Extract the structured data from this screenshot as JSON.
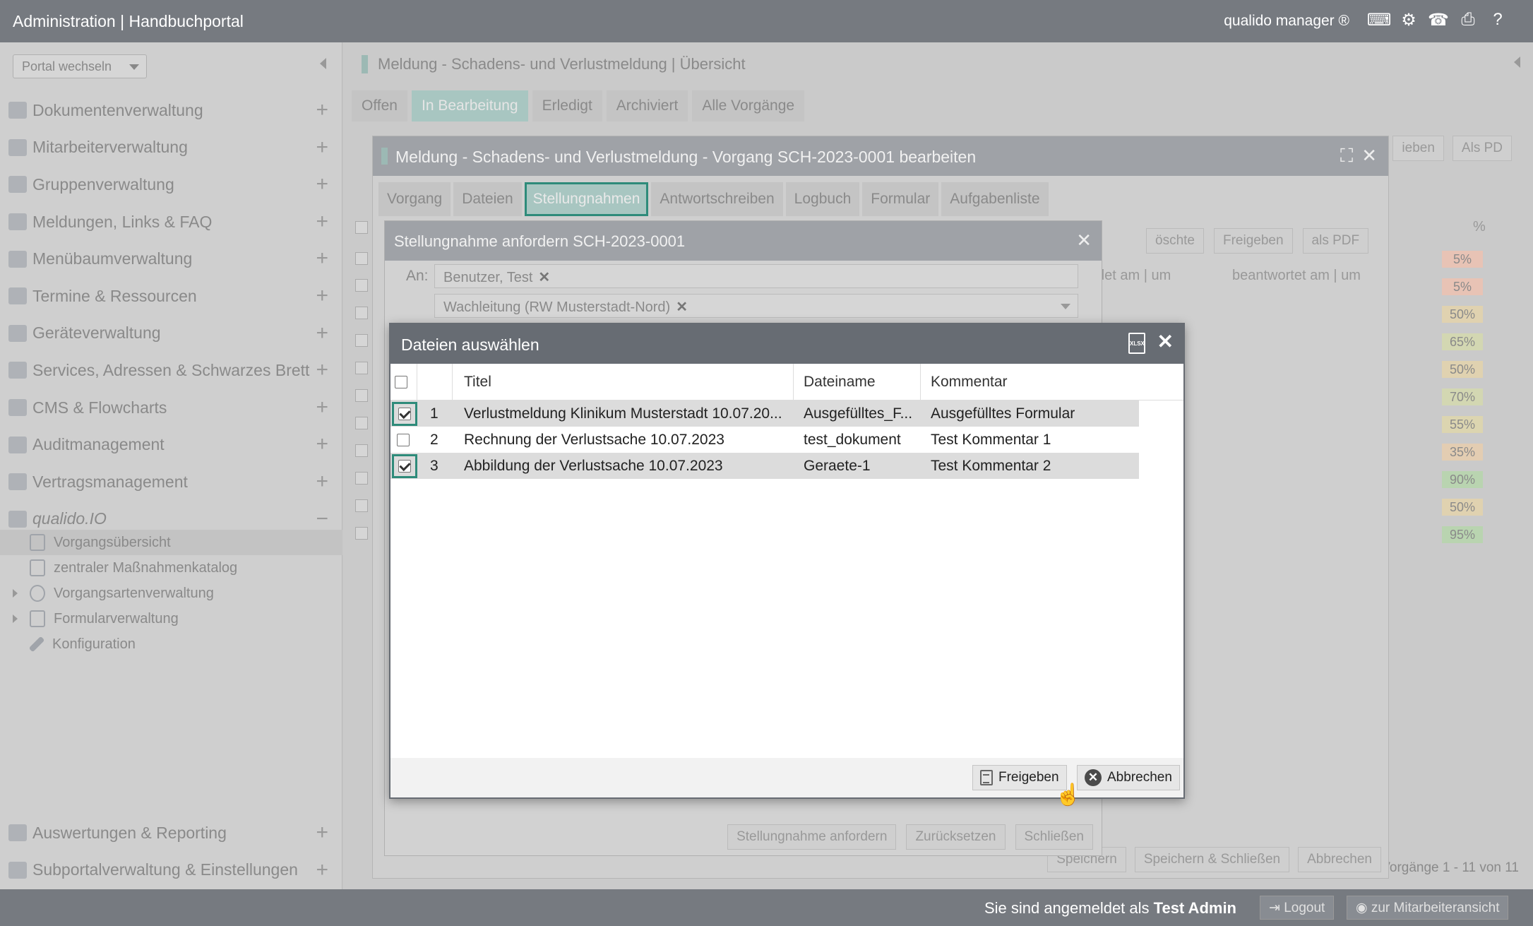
{
  "topbar": {
    "title": "Administration | Handbuchportal",
    "brand": "qualido manager ®",
    "icons": [
      "keyboard-icon",
      "settings-icon",
      "fax-icon",
      "print-icon",
      "help-icon"
    ]
  },
  "sidebar": {
    "portal_select": "Portal wechseln",
    "items": [
      {
        "label": "Dokumentenverwaltung",
        "icon": "documents-icon"
      },
      {
        "label": "Mitarbeiterverwaltung",
        "icon": "users-icon"
      },
      {
        "label": "Gruppenverwaltung",
        "icon": "groups-icon"
      },
      {
        "label": "Meldungen, Links & FAQ",
        "icon": "chat-icon"
      },
      {
        "label": "Menübaumverwaltung",
        "icon": "menu-tree-icon"
      },
      {
        "label": "Termine & Ressourcen",
        "icon": "calendar-icon"
      },
      {
        "label": "Geräteverwaltung",
        "icon": "device-icon"
      },
      {
        "label": "Services, Adressen & Schwarzes Brett",
        "icon": "address-book-icon"
      },
      {
        "label": "CMS & Flowcharts",
        "icon": "cms-icon"
      },
      {
        "label": "Auditmanagement",
        "icon": "audit-icon"
      },
      {
        "label": "Vertragsmanagement",
        "icon": "paragraph-icon"
      },
      {
        "label": "qualido.IO",
        "icon": "qualido-io-icon"
      }
    ],
    "sub_items": [
      {
        "label": "Vorgangsübersicht"
      },
      {
        "label": "zentraler Maßnahmenkatalog"
      },
      {
        "label": "Vorgangsartenverwaltung"
      },
      {
        "label": "Formularverwaltung"
      },
      {
        "label": "Konfiguration"
      }
    ],
    "bottom_items": [
      {
        "label": "Auswertungen & Reporting",
        "icon": "chart-icon"
      },
      {
        "label": "Subportalverwaltung & Einstellungen",
        "icon": "home-icon"
      }
    ]
  },
  "background": {
    "title": "Meldung - Schadens- und Verlustmeldung | Übersicht",
    "tabs": [
      "Offen",
      "In Bearbeitung",
      "Erledigt",
      "Archiviert",
      "Alle Vorgänge"
    ],
    "toolbar": [
      "ieben",
      "Als PD"
    ],
    "toolbar2": [
      "öschte",
      "Freigeben",
      "als PDF"
    ],
    "col_headers": [
      "det am | um",
      "beantwortet am | um",
      "%"
    ],
    "percentages": [
      "5%",
      "5%",
      "50%",
      "65%",
      "50%",
      "70%",
      "55%",
      "35%",
      "90%",
      "50%",
      "95%"
    ],
    "count": "Vorgänge 1 - 11 von 11"
  },
  "modal_vorgang": {
    "title": "Meldung - Schadens- und Verlustmeldung - Vorgang SCH-2023-0001 bearbeiten",
    "tabs": [
      "Vorgang",
      "Dateien",
      "Stellungnahmen",
      "Antwortschreiben",
      "Logbuch",
      "Formular",
      "Aufgabenliste"
    ],
    "footer": {
      "save": "Speichern",
      "save_close": "Speichern & Schließen",
      "cancel": "Abbrechen"
    }
  },
  "modal_stellungnahme": {
    "title": "Stellungnahme anfordern SCH-2023-0001",
    "to_label": "An:",
    "recipient_1": "Benutzer, Test",
    "recipient_2": "Wachleitung (RW Musterstadt-Nord)",
    "footer": {
      "request": "Stellungnahme anfordern",
      "reset": "Zurücksetzen",
      "close": "Schließen"
    }
  },
  "dialog": {
    "title": "Dateien auswählen",
    "columns": {
      "title": "Titel",
      "file": "Dateiname",
      "comment": "Kommentar"
    },
    "rows": [
      {
        "num": "1",
        "title": "Verlustmeldung Klinikum Musterstadt 10.07.20...",
        "file": "Ausgefülltes_F...",
        "comment": "Ausgefülltes Formular",
        "checked": true
      },
      {
        "num": "2",
        "title": "Rechnung der Verlustsache 10.07.2023",
        "file": "test_dokument",
        "comment": "Test Kommentar 1",
        "checked": false
      },
      {
        "num": "3",
        "title": "Abbildung der Verlustsache 10.07.2023",
        "file": "Geraete-1",
        "comment": "Test Kommentar 2",
        "checked": true
      }
    ],
    "buttons": {
      "release": "Freigeben",
      "cancel": "Abbrechen"
    }
  },
  "bottombar": {
    "logged_in_prefix": "Sie sind angemeldet als",
    "user": "Test Admin",
    "logout": "Logout",
    "employee_view": "zur Mitarbeiteransicht"
  }
}
